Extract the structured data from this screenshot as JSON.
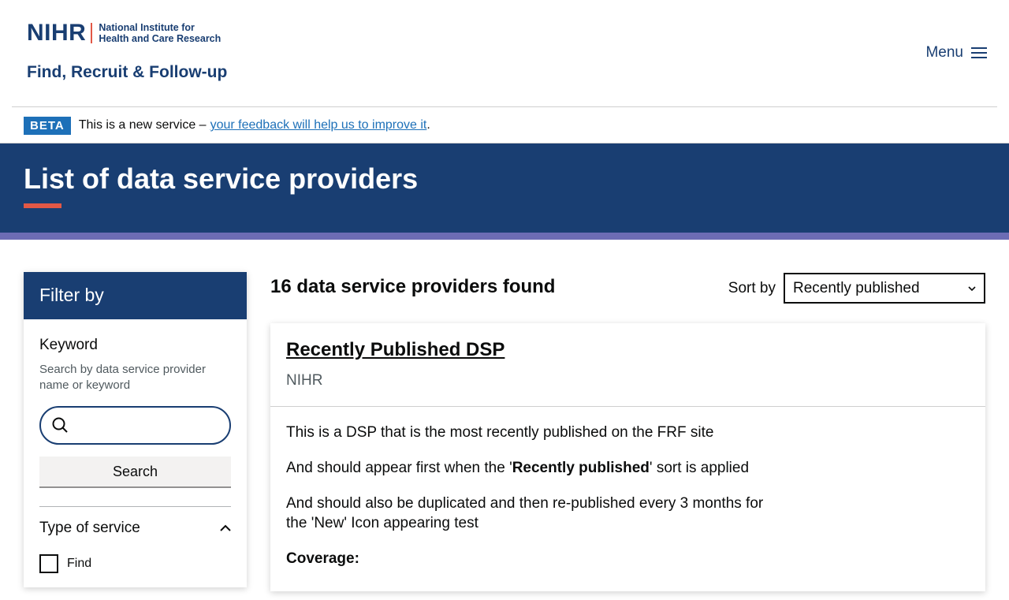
{
  "header": {
    "logo_abbr": "NIHR",
    "logo_line1": "National Institute for",
    "logo_line2": "Health and Care Research",
    "service_name": "Find, Recruit & Follow-up",
    "menu_label": "Menu"
  },
  "beta": {
    "tag": "BETA",
    "text": "This is a new service –",
    "link": "your feedback will help us to improve it",
    "trailing": "."
  },
  "page": {
    "title": "List of data service providers"
  },
  "filter": {
    "heading": "Filter by",
    "keyword_label": "Keyword",
    "keyword_hint": "Search by data service provider name or keyword",
    "search_value": "",
    "search_button": "Search",
    "type_of_service_label": "Type of service",
    "options": [
      "Find"
    ]
  },
  "results": {
    "count_text": "16 data service providers found",
    "sort_label": "Sort by",
    "sort_value": "Recently published"
  },
  "card": {
    "title": "Recently Published DSP",
    "org": "NIHR",
    "para1": "This is a DSP that is the most recently published on the FRF site",
    "para2_before": "And should appear first when the '",
    "para2_bold": "Recently published",
    "para2_after": "' sort is applied",
    "para3": "And should also be duplicated and then re-published every 3 months for the 'New' Icon appearing test",
    "coverage_label": "Coverage:"
  },
  "colors": {
    "brand_navy": "#193e72",
    "accent_red": "#e25846",
    "purple": "#6c6cb4",
    "link_blue": "#1d70b8"
  }
}
